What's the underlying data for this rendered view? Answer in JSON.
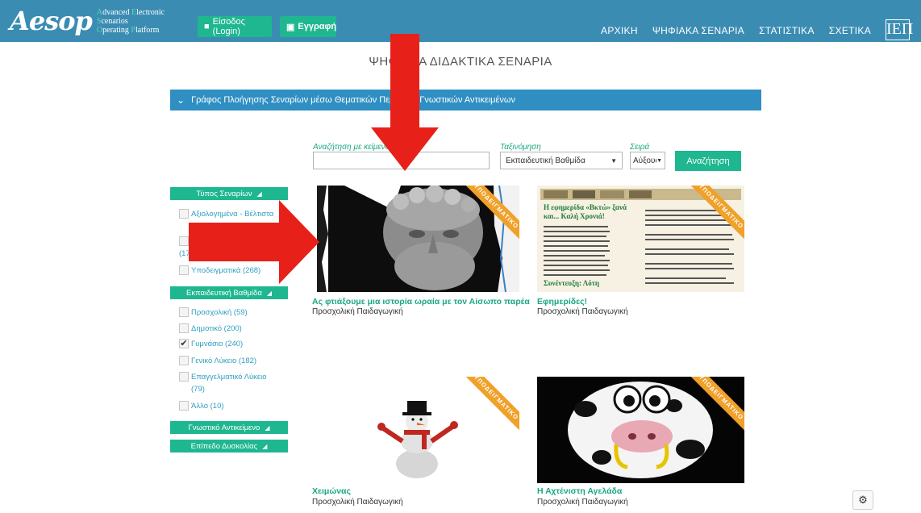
{
  "header": {
    "logo_word": "Aesop",
    "logo_tagline": [
      {
        "initial": "A",
        "rest": "dvanced "
      },
      {
        "initial": "E",
        "rest": "lectronic "
      },
      {
        "initial": "S",
        "rest": "cenarios "
      },
      {
        "initial": "O",
        "rest": "perating "
      },
      {
        "initial": "P",
        "rest": "latform"
      }
    ],
    "login_label": "Είσοδος (Login)",
    "register_label": "Εγγραφή",
    "nav": [
      "ΑΡΧΙΚΗ",
      "ΨΗΦΙΑΚΑ ΣΕΝΑΡΙΑ",
      "ΣΤΑΤΙΣΤΙΚΑ",
      "ΣΧΕΤΙΚΑ"
    ],
    "partner_logo": "ΙΕΠ"
  },
  "page_title": "ΨΗΦΙΑΚΑ ΔΙΔΑΚΤΙΚΑ ΣΕΝΑΡΙΑ",
  "graph_bar_label": "Γράφος Πλοήγησης Σεναρίων μέσω Θεματικών Περιοχών Γνωστικών Αντικειμένων",
  "search": {
    "text_label": "Αναζήτηση με κείμενο",
    "text_value": "",
    "sort_label": "Ταξινόμηση",
    "sort_value": "Εκπαιδευτική Βαθμίδα",
    "order_label": "Σειρά",
    "order_value": "Αύξουσα",
    "button_label": "Αναζήτηση"
  },
  "sidebar": {
    "type_heading": "Τύπος Σεναρίων",
    "type_items": [
      "Αξιολογημένα - Βέλτιστα (33)",
      "(172)",
      "Υποδειγματικά (268)"
    ],
    "level_heading": "Εκπαιδευτική Βαθμίδα",
    "level_items": [
      {
        "label": "Προσχολική (59)",
        "checked": false
      },
      {
        "label": "Δημοτικό (200)",
        "checked": false
      },
      {
        "label": "Γυμνάσιο (240)",
        "checked": true
      },
      {
        "label": "Γενικό Λύκειο (182)",
        "checked": false
      },
      {
        "label": "Επαγγελματικό Λύκειο (79)",
        "checked": false
      },
      {
        "label": "Άλλο (10)",
        "checked": false
      }
    ],
    "subject_heading": "Γνωστικό Αντικείμενο",
    "difficulty_heading": "Επίπεδο Δυσκολίας"
  },
  "cards": [
    {
      "title": "Ας φτιάξουμε μια ιστορία ωραία με τον Αίσωπο παρέα",
      "level": "Προσχολική Παιδαγωγική",
      "ribbon": "ΥΠΟΔΕΙΓΜΑΤΙΚΟ"
    },
    {
      "title": "Εφημερίδες!",
      "level": "Προσχολική Παιδαγωγική",
      "ribbon": "ΥΠΟΔΕΙΓΜΑΤΙΚΟ",
      "newspaper_headline": "Η εφημερίδα «Βκτώ» ξανά και... Καλή Χρονιά!"
    },
    {
      "title": "Χειμώνας",
      "level": "Προσχολική Παιδαγωγική",
      "ribbon": "ΥΠΟΔΕΙΓΜΑΤΙΚΟ"
    },
    {
      "title": "Η Αχτένιστη Αγελάδα",
      "level": "Προσχολική Παιδαγωγική",
      "ribbon": "ΥΠΟΔΕΙΓΜΑΤΙΚΟ"
    }
  ],
  "colors": {
    "navbar": "#3b8cb3",
    "accent": "#1fb78f",
    "ribbon": "#f0a12a",
    "annotation_arrow": "#e8201a"
  },
  "icons": {
    "login": "user-icon",
    "register": "lock-icon",
    "settings": "gears-icon",
    "collapse": "chevron-down-icon",
    "filter": "caret-icon"
  }
}
